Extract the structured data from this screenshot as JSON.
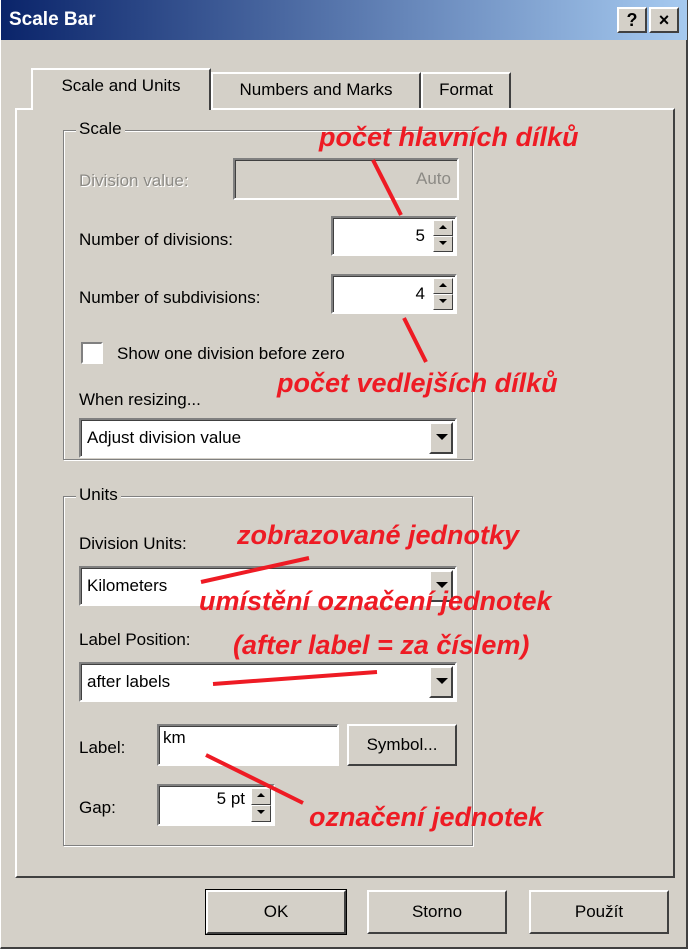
{
  "window": {
    "title": "Scale Bar",
    "help_label": "?",
    "close_label": "×"
  },
  "tabs": [
    {
      "label": "Scale and Units",
      "active": true
    },
    {
      "label": "Numbers and Marks",
      "active": false
    },
    {
      "label": "Format",
      "active": false
    }
  ],
  "scale": {
    "group_title": "Scale",
    "division_value_label": "Division value:",
    "division_value": "Auto",
    "num_divisions_label": "Number of divisions:",
    "num_divisions": "5",
    "num_subdivisions_label": "Number of subdivisions:",
    "num_subdivisions": "4",
    "show_before_zero_label": "Show one division before zero",
    "show_before_zero_checked": false,
    "when_resizing_label": "When resizing...",
    "when_resizing_value": "Adjust division value"
  },
  "units": {
    "group_title": "Units",
    "division_units_label": "Division Units:",
    "division_units_value": "Kilometers",
    "label_position_label": "Label Position:",
    "label_position_value": "after labels",
    "label_label": "Label:",
    "label_value": "km",
    "symbol_button": "Symbol...",
    "gap_label": "Gap:",
    "gap_value": "5 pt"
  },
  "buttons": {
    "ok": "OK",
    "cancel": "Storno",
    "apply": "Použít"
  },
  "annotations": {
    "main_divisions": "počet hlavních dílků",
    "subdivisions": "počet vedlejších dílků",
    "display_units": "zobrazované jednotky",
    "label_placement": "umístění označení jednotek",
    "label_placement_note": "(after label = za číslem)",
    "unit_label": "označení jednotek",
    "color": "#ee1b24"
  }
}
